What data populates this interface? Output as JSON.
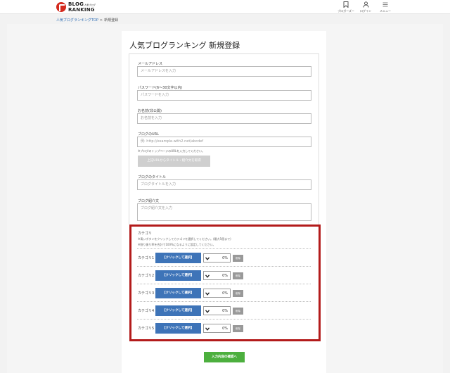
{
  "header": {
    "logo_line1": "BLOG",
    "logo_sub": "人気ブログ",
    "logo_line2": "RANKING",
    "nav": [
      {
        "label": "ブロガーズー",
        "icon": "bookmark-icon"
      },
      {
        "label": "ログイン",
        "icon": "user-icon"
      },
      {
        "label": "メニュー",
        "icon": "menu-icon"
      }
    ]
  },
  "breadcrumb": {
    "home": "人気ブログランキングTOP",
    "separator": ">",
    "current": "新規登録"
  },
  "page": {
    "title": "人気ブログランキング 新規登録"
  },
  "form": {
    "email": {
      "label": "メールアドレス",
      "placeholder": "メールアドレスを入力"
    },
    "password": {
      "label": "パスワード(6〜30文字以内)",
      "placeholder": "パスワードを入力"
    },
    "name": {
      "label": "お名前(非公開)",
      "placeholder": "お名前を入力"
    },
    "blog_url": {
      "label": "ブログのURL",
      "placeholder": "例: http://example.with2.net/abcdef",
      "note": "※ブログのトップページのURLを入力してください。",
      "fetch_button": "上記URLからタイトル・紹介文を取得"
    },
    "blog_title": {
      "label": "ブログのタイトル",
      "placeholder": "ブログタイトルを入力"
    },
    "blog_intro": {
      "label": "ブログ紹介文",
      "placeholder": "ブログ紹介文を入力"
    }
  },
  "categories": {
    "title": "カテゴリ",
    "note1": "※青いボタンをクリックしてカテゴリを選択してください。(最大5個まで)",
    "note2": "※割り振り率を合計で100%になるように設定してください。",
    "rows": [
      {
        "label": "カテゴリ1",
        "button": "【クリックして選択】",
        "percent": "0%",
        "delete": "削除"
      },
      {
        "label": "カテゴリ2",
        "button": "【クリックして選択】",
        "percent": "0%",
        "delete": "削除"
      },
      {
        "label": "カテゴリ3",
        "button": "【クリックして選択】",
        "percent": "0%",
        "delete": "削除"
      },
      {
        "label": "カテゴリ4",
        "button": "【クリックして選択】",
        "percent": "0%",
        "delete": "削除"
      },
      {
        "label": "カテゴリ5",
        "button": "【クリックして選択】",
        "percent": "0%",
        "delete": "削除"
      }
    ]
  },
  "confirm_button": "入力内容の確認へ",
  "colors": {
    "logo_red": "#d42a1e",
    "category_button": "#3e74b8",
    "confirm_button": "#4caf3e",
    "highlight_border": "#b31b1b"
  }
}
